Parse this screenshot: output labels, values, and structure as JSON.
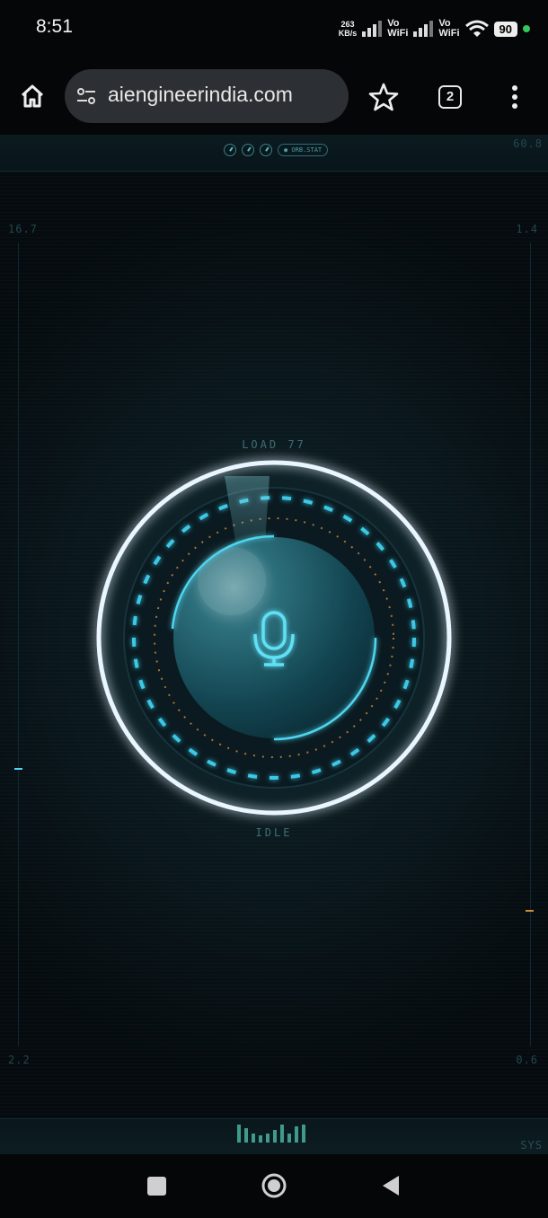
{
  "status_bar": {
    "time": "8:51",
    "net_speed_value": "263",
    "net_speed_unit": "KB/s",
    "sim1_label_top": "Vo",
    "sim1_label_bottom": "WiFi",
    "sim2_label_top": "Vo",
    "sim2_label_bottom": "WiFi",
    "battery": "90",
    "icons": [
      "signal-icon",
      "signal-icon",
      "wifi-icon",
      "battery-icon",
      "privacy-dot-icon"
    ]
  },
  "browser": {
    "url": "aiengineerindia.com",
    "tab_count": "2",
    "icons": [
      "home-icon",
      "site-info-icon",
      "star-icon",
      "tab-switcher-icon",
      "more-menu-icon"
    ]
  },
  "hud": {
    "top_pill": "● ORB.STAT",
    "top_right_value": "60.8",
    "left_top_value": "16.7",
    "right_top_value": "1.4",
    "left_bottom_value": "2.2",
    "right_bottom_value": "0.6",
    "bottom_right_label": "SYS",
    "load_label": "LOAD 77",
    "state_label": "IDLE",
    "icon": "microphone-icon",
    "colors": {
      "accent": "#4fd6ef",
      "orange": "#d28a3a",
      "ring": "#eaf6ff"
    }
  },
  "navbar": {
    "icons": [
      "recents-icon",
      "home-circle-icon",
      "back-icon"
    ]
  }
}
